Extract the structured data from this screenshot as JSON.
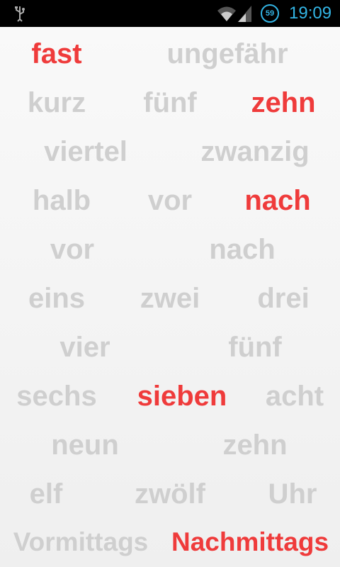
{
  "status_bar": {
    "battery_level": "59",
    "time": "19:09",
    "icons": [
      "usb-icon",
      "wifi-icon",
      "signal-icon",
      "battery-icon"
    ],
    "accent_color": "#33b5e5"
  },
  "colors": {
    "active_word": "#ef3b3b",
    "inactive_word": "#cfcfcf",
    "status_text": "#33b5e5"
  },
  "words": [
    {
      "text": "fast",
      "active": true
    },
    {
      "text": "ungefähr",
      "active": false
    },
    {
      "text": "kurz",
      "active": false
    },
    {
      "text": "fünf",
      "active": false
    },
    {
      "text": "zehn",
      "active": true
    },
    {
      "text": "viertel",
      "active": false
    },
    {
      "text": "zwanzig",
      "active": false
    },
    {
      "text": "halb",
      "active": false
    },
    {
      "text": "vor",
      "active": false
    },
    {
      "text": "nach",
      "active": true
    },
    {
      "text": "vor",
      "active": false
    },
    {
      "text": "nach",
      "active": false
    },
    {
      "text": "eins",
      "active": false
    },
    {
      "text": "zwei",
      "active": false
    },
    {
      "text": "drei",
      "active": false
    },
    {
      "text": "vier",
      "active": false
    },
    {
      "text": "fünf",
      "active": false
    },
    {
      "text": "sechs",
      "active": false
    },
    {
      "text": "sieben",
      "active": true
    },
    {
      "text": "acht",
      "active": false
    },
    {
      "text": "neun",
      "active": false
    },
    {
      "text": "zehn",
      "active": false
    },
    {
      "text": "elf",
      "active": false
    },
    {
      "text": "zwölf",
      "active": false
    },
    {
      "text": "Uhr",
      "active": false
    },
    {
      "text": "Vormittags",
      "active": false
    },
    {
      "text": "Nachmittags",
      "active": true
    }
  ]
}
